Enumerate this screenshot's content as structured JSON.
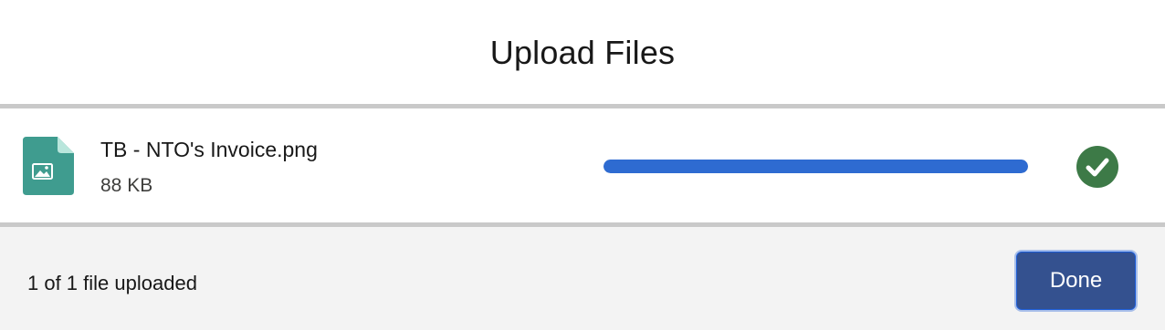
{
  "modal": {
    "title": "Upload Files"
  },
  "file": {
    "name": "TB - NTO's Invoice.png",
    "size": "88 KB",
    "icon": "image-file-icon",
    "progress_percent": 100,
    "status_icon": "success-check-icon"
  },
  "footer": {
    "status_text": "1 of 1 file uploaded",
    "done_label": "Done"
  },
  "colors": {
    "file_icon": "#3f9c8f",
    "file_icon_fold": "#b9e6dc",
    "progress_fill": "#2e6bd1",
    "success": "#3d7a47",
    "done_button": "#34518f",
    "footer_bg": "#f3f3f3",
    "divider": "#c9c9c9"
  }
}
